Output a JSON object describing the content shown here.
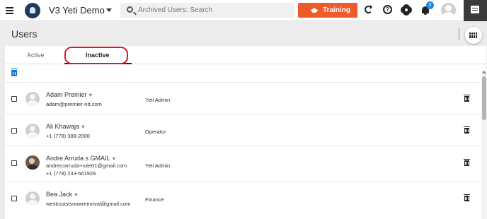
{
  "header": {
    "app_title": "V3 Yeti Demo",
    "search_placeholder": "Archived Users: Search",
    "training_label": "Training",
    "notification_count": "3",
    "help_glyph": "?",
    "icons": [
      "menu-icon",
      "yeti-logo",
      "chevron-down-icon",
      "search-icon",
      "graduation-cap-icon",
      "refresh-icon",
      "help-icon",
      "gear-icon",
      "bell-icon",
      "user-avatar",
      "chat-icon"
    ],
    "accent_color": "#f05a28",
    "badge_color": "#1e88e5"
  },
  "page": {
    "title": "Users",
    "view_toggle_icon": "grid-view-icon"
  },
  "tabs": [
    {
      "label": "Active",
      "selected": false
    },
    {
      "label": "Inactive",
      "selected": true
    }
  ],
  "toolbar": {
    "bulk_delete_icon": "trash-icon",
    "bulk_delete_color": "#1976d2"
  },
  "users": [
    {
      "name": "Adam Premier",
      "lines": [
        "adam@premier-nd.com"
      ],
      "role": "Yeti Admin",
      "avatar": "default"
    },
    {
      "name": "Ali Khawaja",
      "lines": [
        "+1 (778) 388-2000"
      ],
      "role": "Operator",
      "avatar": "default"
    },
    {
      "name": "Andre Arruda s GMAIL",
      "lines": [
        "andrercarruda+role01@gmail.com",
        "+1 (778) 233-561928"
      ],
      "role": "Yeti Admin",
      "avatar": "photo"
    },
    {
      "name": "Bea Jack",
      "lines": [
        "westcoastsnowremoval@gmail.com"
      ],
      "role": "Finance",
      "avatar": "default"
    }
  ],
  "favorite_glyph": "♥"
}
